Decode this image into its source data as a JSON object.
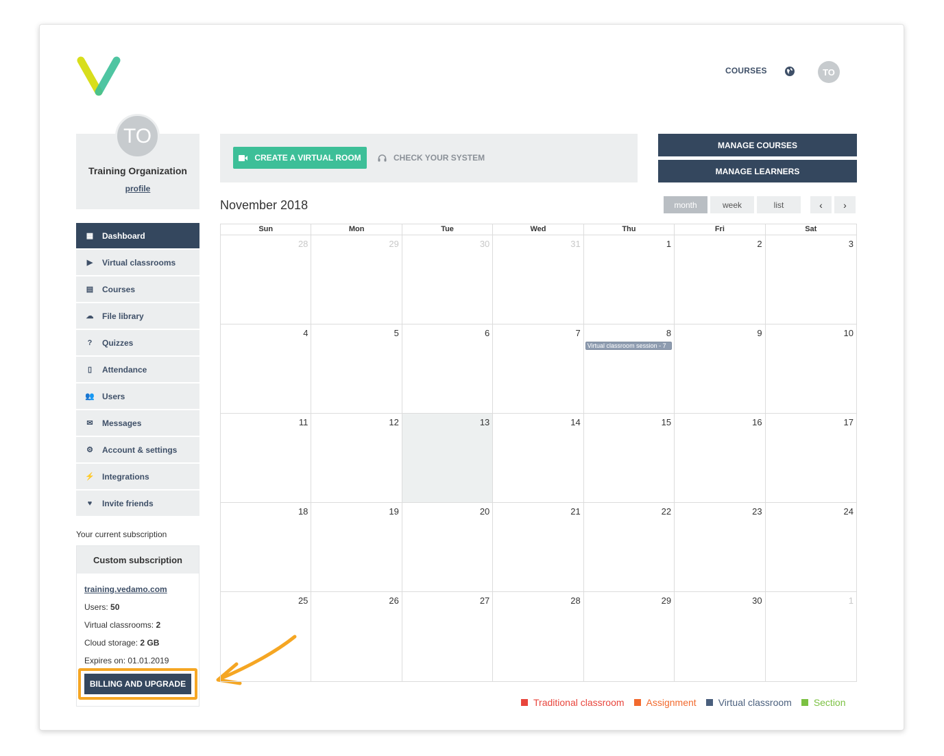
{
  "header": {
    "courses_label": "COURSES",
    "avatar_initials": "TO"
  },
  "profile": {
    "initials": "TO",
    "org_name": "Training Organization",
    "profile_link": "profile"
  },
  "sidebar": {
    "items": [
      {
        "label": "Dashboard",
        "icon": "dashboard-icon",
        "active": true
      },
      {
        "label": "Virtual classrooms",
        "icon": "play-circle-icon"
      },
      {
        "label": "Courses",
        "icon": "book-icon"
      },
      {
        "label": "File library",
        "icon": "cloud-icon"
      },
      {
        "label": "Quizzes",
        "icon": "question-circle-icon"
      },
      {
        "label": "Attendance",
        "icon": "document-icon"
      },
      {
        "label": "Users",
        "icon": "users-icon"
      },
      {
        "label": "Messages",
        "icon": "envelope-icon"
      },
      {
        "label": "Account & settings",
        "icon": "gear-icon"
      },
      {
        "label": "Integrations",
        "icon": "plug-icon"
      },
      {
        "label": "Invite friends",
        "icon": "heart-icon"
      }
    ]
  },
  "subscription": {
    "label": "Your current subscription",
    "title": "Custom subscription",
    "domain": "training.vedamo.com",
    "users_label": "Users:",
    "users_value": "50",
    "classrooms_label": "Virtual classrooms:",
    "classrooms_value": "2",
    "storage_label": "Cloud storage:",
    "storage_value": "2 GB",
    "expires_label": "Expires on:",
    "expires_value": "01.01.2019",
    "billing_button": "BILLING AND UPGRADE"
  },
  "actions": {
    "create_room": "CREATE A VIRTUAL ROOM",
    "check_system": "CHECK YOUR SYSTEM",
    "manage_courses": "MANAGE COURSES",
    "manage_learners": "MANAGE LEARNERS"
  },
  "calendar": {
    "title": "November 2018",
    "views": [
      "month",
      "week",
      "list"
    ],
    "active_view": "month",
    "weekdays": [
      "Sun",
      "Mon",
      "Tue",
      "Wed",
      "Thu",
      "Fri",
      "Sat"
    ],
    "days": [
      {
        "n": "28",
        "other": true
      },
      {
        "n": "29",
        "other": true
      },
      {
        "n": "30",
        "other": true
      },
      {
        "n": "31",
        "other": true
      },
      {
        "n": "1"
      },
      {
        "n": "2"
      },
      {
        "n": "3"
      },
      {
        "n": "4"
      },
      {
        "n": "5"
      },
      {
        "n": "6"
      },
      {
        "n": "7"
      },
      {
        "n": "8",
        "event": "Virtual classroom session - 7"
      },
      {
        "n": "9"
      },
      {
        "n": "10"
      },
      {
        "n": "11"
      },
      {
        "n": "12"
      },
      {
        "n": "13",
        "today": true
      },
      {
        "n": "14"
      },
      {
        "n": "15"
      },
      {
        "n": "16"
      },
      {
        "n": "17"
      },
      {
        "n": "18"
      },
      {
        "n": "19"
      },
      {
        "n": "20"
      },
      {
        "n": "21"
      },
      {
        "n": "22"
      },
      {
        "n": "23"
      },
      {
        "n": "24"
      },
      {
        "n": "25"
      },
      {
        "n": "26"
      },
      {
        "n": "27"
      },
      {
        "n": "28"
      },
      {
        "n": "29"
      },
      {
        "n": "30"
      },
      {
        "n": "1",
        "other": true
      }
    ]
  },
  "legend": [
    {
      "label": "Traditional classroom",
      "color": "#e8453c"
    },
    {
      "label": "Assignment",
      "color": "#f26a2e"
    },
    {
      "label": "Virtual classroom",
      "color": "#4a5f7d"
    },
    {
      "label": "Section",
      "color": "#7bc142"
    }
  ],
  "colors": {
    "primary_dark": "#34475e",
    "accent_green": "#3dbf98",
    "highlight_orange": "#f5a623"
  }
}
